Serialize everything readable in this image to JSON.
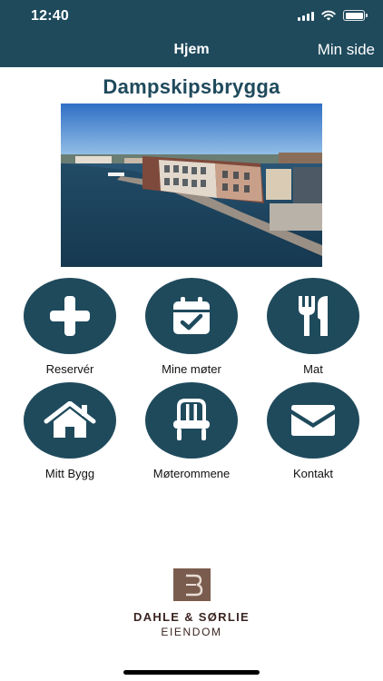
{
  "status_bar": {
    "time": "12:40"
  },
  "nav": {
    "title": "Hjem",
    "right_link": "Min side"
  },
  "page": {
    "title": "Dampskipsbrygga"
  },
  "menu": [
    {
      "label": "Reservér",
      "icon": "plus-icon"
    },
    {
      "label": "Mine møter",
      "icon": "calendar-check-icon"
    },
    {
      "label": "Mat",
      "icon": "fork-knife-icon"
    },
    {
      "label": "Mitt Bygg",
      "icon": "house-icon"
    },
    {
      "label": "Møterommene",
      "icon": "chair-icon"
    },
    {
      "label": "Kontakt",
      "icon": "envelope-icon"
    }
  ],
  "footer": {
    "brand": "DAHLE & SØRLIE",
    "sub": "EIENDOM"
  },
  "colors": {
    "primary": "#1f4a5c",
    "logo_brown": "#3a2420"
  }
}
